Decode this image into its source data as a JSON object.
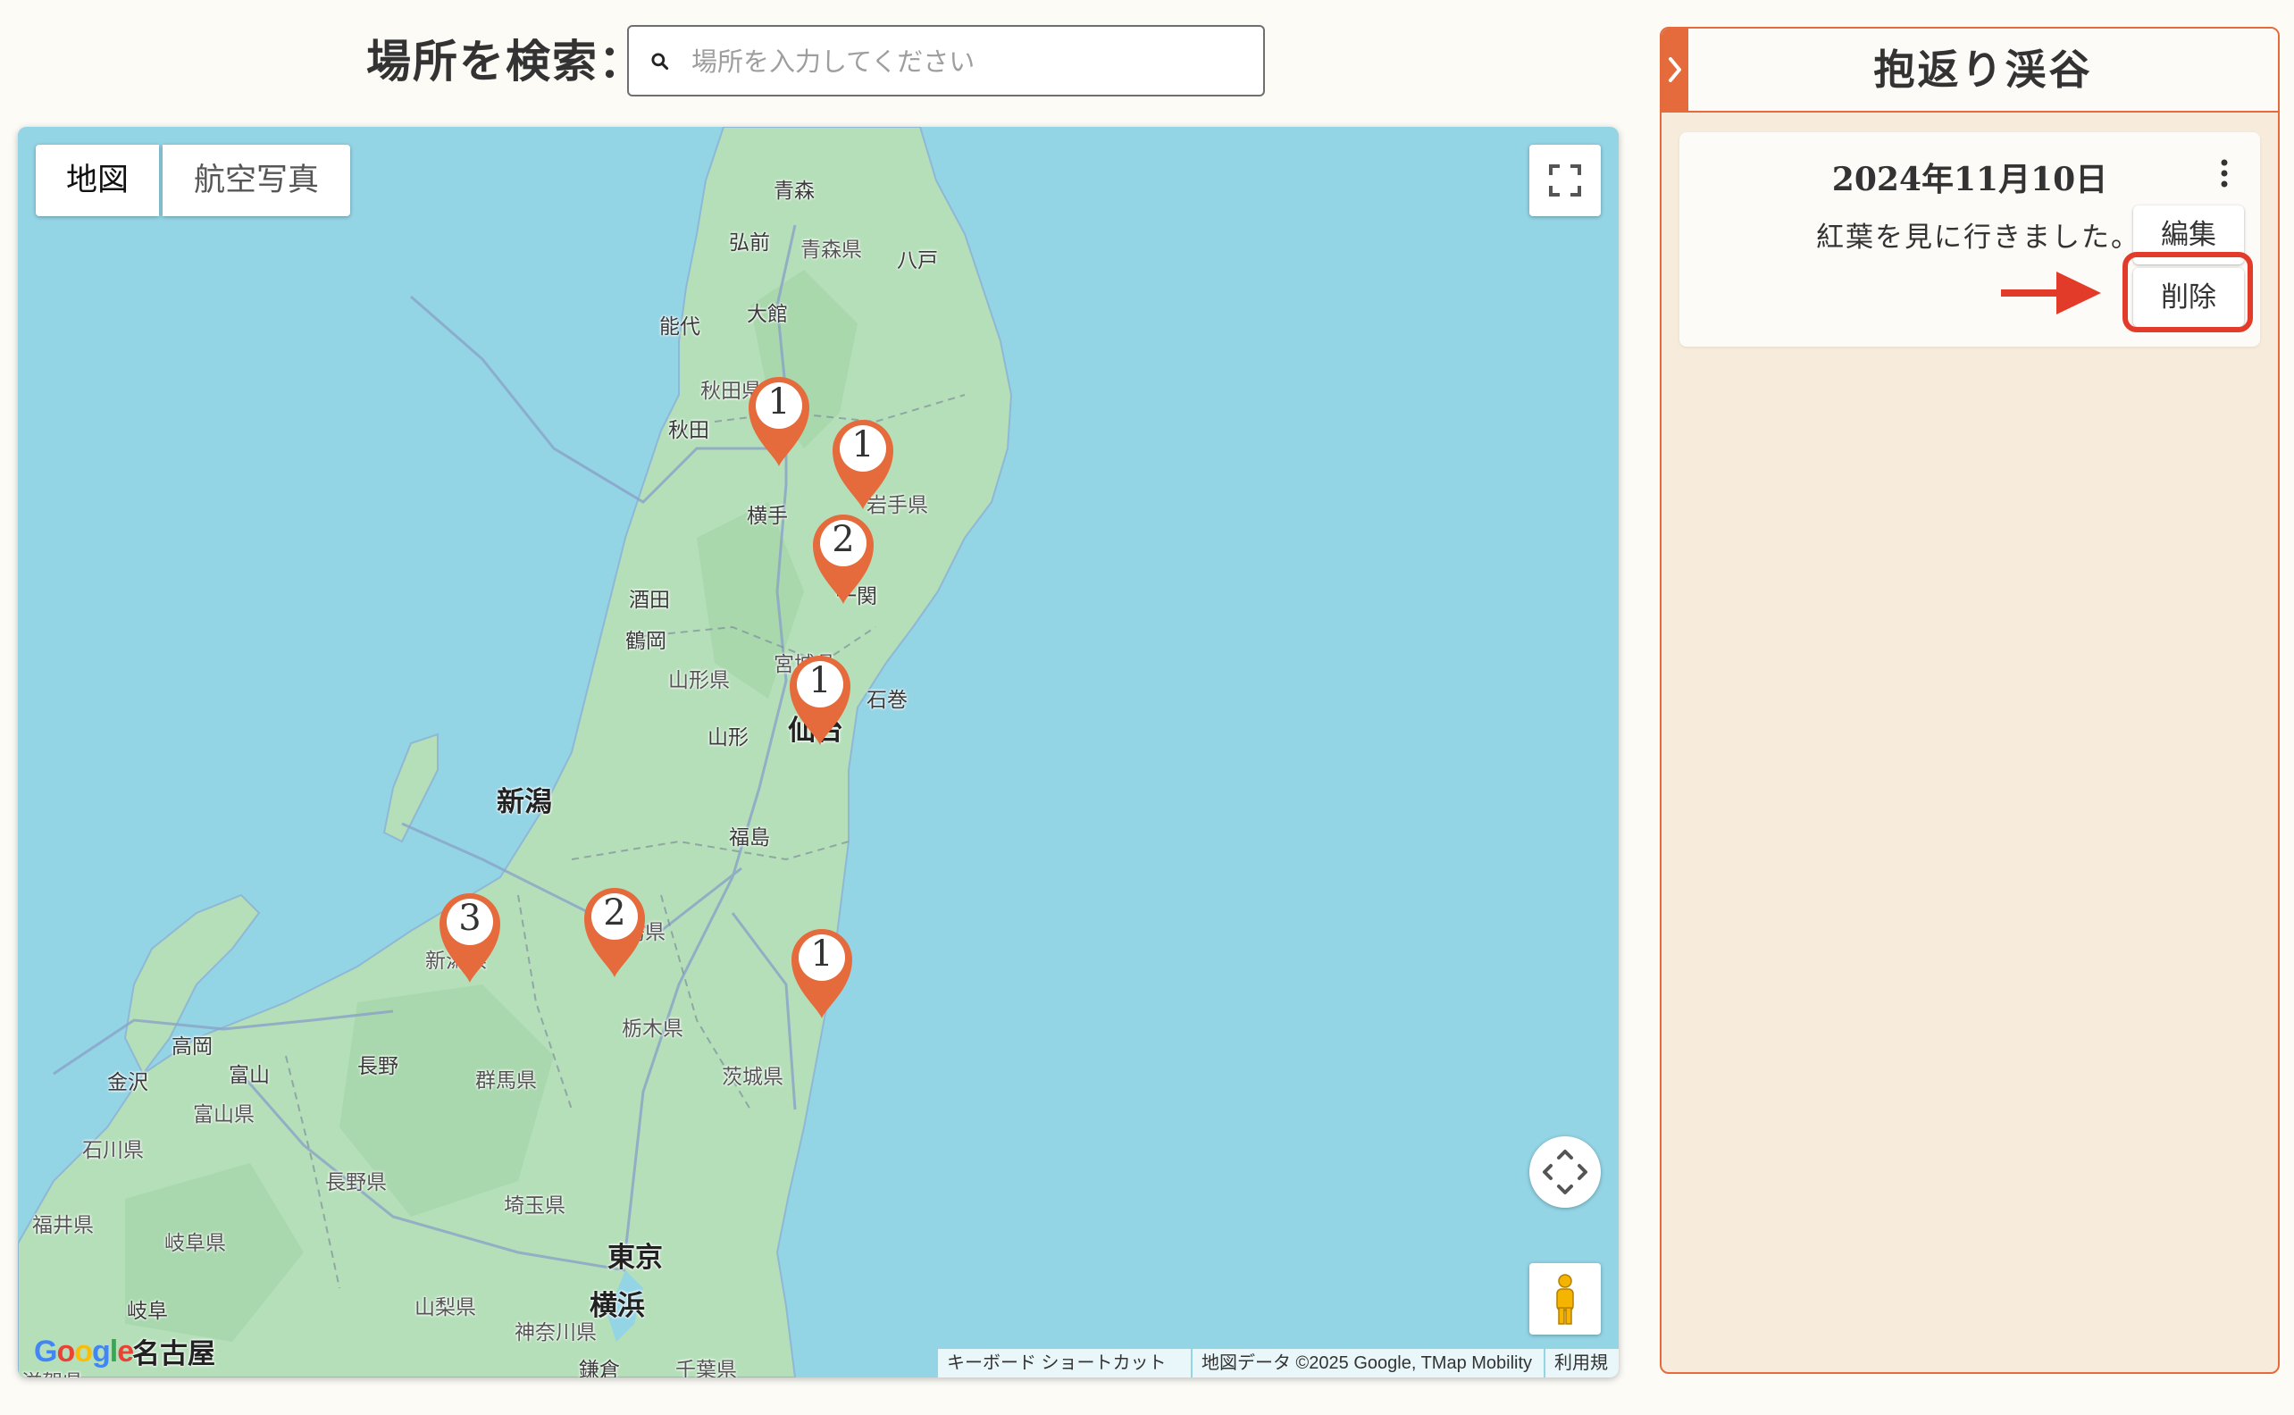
{
  "search": {
    "label": "場所を検索：",
    "placeholder": "場所を入力してください"
  },
  "map": {
    "type_buttons": [
      "地図",
      "航空写真"
    ],
    "logo": "Google",
    "attribution": {
      "keyboard": "キーボード ショートカット",
      "data": "地図データ ©2025 Google, TMap Mobility",
      "terms": "利用規約"
    },
    "places": {
      "aomori": "青森",
      "hirosaki": "弘前",
      "aomori_pref": "青森県",
      "hachinohe": "八戸",
      "noshiro": "能代",
      "odate": "大館",
      "akita_pref": "秋田県",
      "akita": "秋田",
      "iwate_pref": "岩手県",
      "yokote": "横手",
      "sakata": "酒田",
      "tsuruoka": "鶴岡",
      "ichinoseki": "一関",
      "miyagi_pref": "宮城県",
      "yamagata_pref": "山形県",
      "ishinomaki": "石巻",
      "yamagata": "山形",
      "sendai": "仙台",
      "niigata": "新潟",
      "fukushima": "福島",
      "niigata_pref": "新潟県",
      "fukushima_pref": "福島県",
      "tochigi_pref": "栃木県",
      "takaoka": "高岡",
      "toyama": "富山",
      "nagano": "長野",
      "kanazawa": "金沢",
      "toyama_pref": "富山県",
      "gunma_pref": "群馬県",
      "ibaraki_pref": "茨城県",
      "ishikawa_pref": "石川県",
      "nagano_pref": "長野県",
      "saitama_pref": "埼玉県",
      "fukui_pref": "福井県",
      "gifu_pref": "岐阜県",
      "tokyo": "東京",
      "gifu": "岐阜",
      "yokohama": "横浜",
      "yamanashi_pref": "山梨県",
      "nagoya": "名古屋",
      "kanagawa_pref": "神奈川県",
      "kamakura": "鎌倉",
      "chiba_pref": "千葉県",
      "shiga_pref": "滋賀県"
    },
    "markers": [
      "1",
      "1",
      "2",
      "1",
      "3",
      "2",
      "1"
    ],
    "accent_color": "#e56b3c"
  },
  "panel": {
    "title": "抱返り渓谷",
    "entry": {
      "date": "2024年11月10日",
      "note": "紅葉を見に行きました。",
      "edit_label": "編集",
      "delete_label": "削除"
    }
  },
  "colors": {
    "accent": "#e56b3c",
    "highlight": "#e33b2a",
    "panel_bg": "#f7ebdc",
    "sea": "#93d4e5",
    "land": "#b3dfb7"
  }
}
